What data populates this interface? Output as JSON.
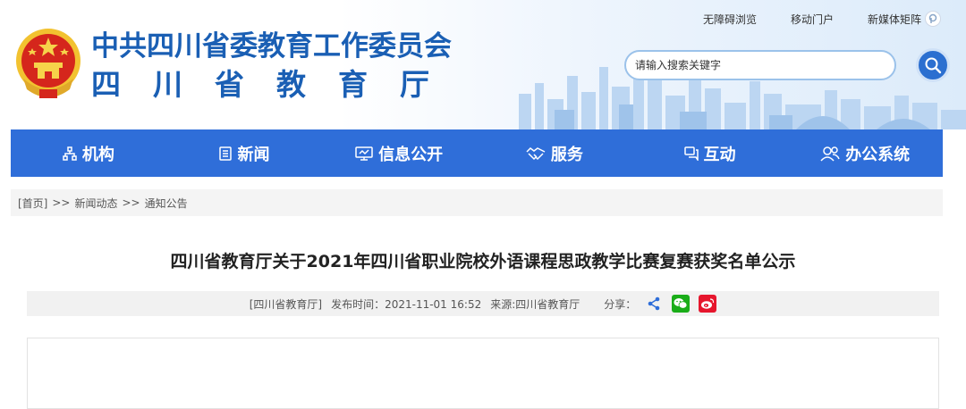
{
  "header": {
    "org_title": "中共四川省委教育工作委员会",
    "org_subtitle": "四川省教育厅",
    "toplinks": {
      "accessible": "无障碍浏览",
      "mobile": "移动门户",
      "media_matrix": "新媒体矩阵"
    },
    "search": {
      "placeholder": "请输入搜索关键字"
    },
    "brand_blue": "#1a5fb4"
  },
  "nav": {
    "color": "#2f6ed9",
    "items": [
      {
        "label": "机构",
        "icon": "org-structure-icon"
      },
      {
        "label": "新闻",
        "icon": "news-icon"
      },
      {
        "label": "信息公开",
        "icon": "monitor-icon"
      },
      {
        "label": "服务",
        "icon": "handshake-icon"
      },
      {
        "label": "互动",
        "icon": "chat-icon"
      },
      {
        "label": "办公系统",
        "icon": "users-icon"
      }
    ]
  },
  "breadcrumb": {
    "home": "[首页]",
    "separator": ">>",
    "level1": "新闻动态",
    "level2": "通知公告"
  },
  "article": {
    "title": "四川省教育厅关于2021年四川省职业院校外语课程思政教学比赛复赛获奖名单公示",
    "meta": {
      "publisher": "[四川省教育厅]",
      "publish_time": "发布时间：2021-11-01 16:52",
      "source": "来源:四川省教育厅",
      "share_label": "分享："
    }
  }
}
